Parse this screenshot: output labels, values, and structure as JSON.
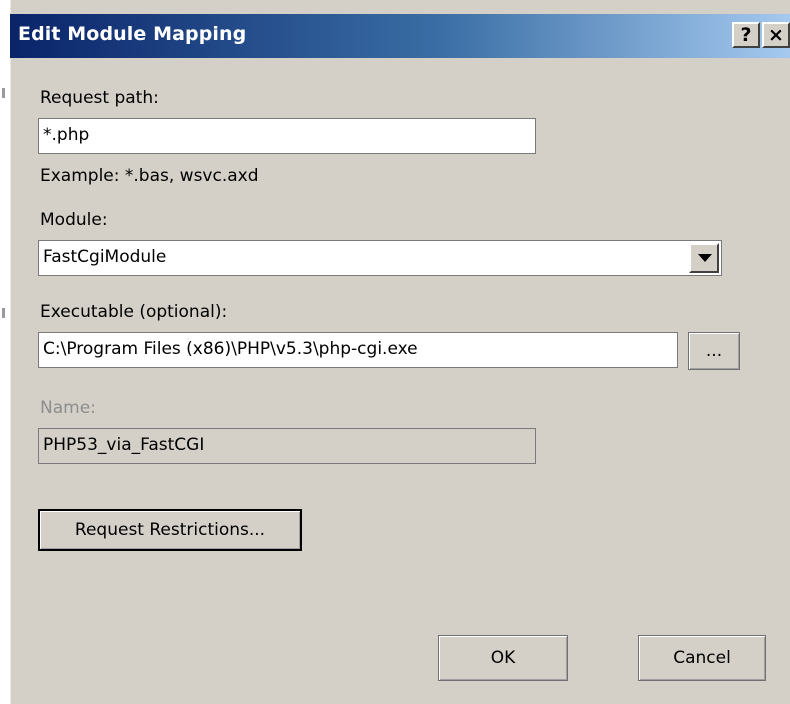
{
  "dialog": {
    "title": "Edit Module Mapping",
    "help_label": "?",
    "close_label": "×"
  },
  "request_path": {
    "label": "Request path:",
    "value": "*.php",
    "example": "Example: *.bas, wsvc.axd"
  },
  "module": {
    "label": "Module:",
    "selected": "FastCgiModule"
  },
  "executable": {
    "label": "Executable (optional):",
    "value": "C:\\Program Files (x86)\\PHP\\v5.3\\php-cgi.exe",
    "browse_label": "..."
  },
  "name": {
    "label": "Name:",
    "value": "PHP53_via_FastCGI"
  },
  "buttons": {
    "request_restrictions": "Request Restrictions...",
    "ok": "OK",
    "cancel": "Cancel"
  }
}
